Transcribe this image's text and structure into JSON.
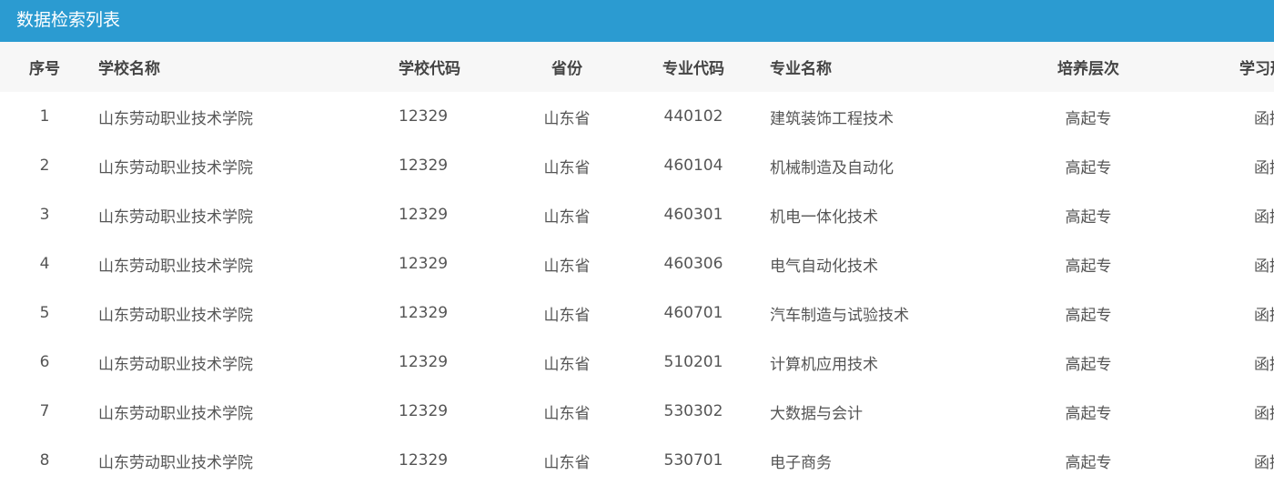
{
  "header": {
    "title": "数据检索列表"
  },
  "columns": {
    "index": "序号",
    "school_name": "学校名称",
    "school_code": "学校代码",
    "province": "省份",
    "major_code": "专业代码",
    "major_name": "专业名称",
    "level": "培养层次",
    "study_mode": "学习形式"
  },
  "rows": [
    {
      "index": "1",
      "school_name": "山东劳动职业技术学院",
      "school_code": "12329",
      "province": "山东省",
      "major_code": "440102",
      "major_name": "建筑装饰工程技术",
      "level": "高起专",
      "study_mode": "函授"
    },
    {
      "index": "2",
      "school_name": "山东劳动职业技术学院",
      "school_code": "12329",
      "province": "山东省",
      "major_code": "460104",
      "major_name": "机械制造及自动化",
      "level": "高起专",
      "study_mode": "函授"
    },
    {
      "index": "3",
      "school_name": "山东劳动职业技术学院",
      "school_code": "12329",
      "province": "山东省",
      "major_code": "460301",
      "major_name": "机电一体化技术",
      "level": "高起专",
      "study_mode": "函授"
    },
    {
      "index": "4",
      "school_name": "山东劳动职业技术学院",
      "school_code": "12329",
      "province": "山东省",
      "major_code": "460306",
      "major_name": "电气自动化技术",
      "level": "高起专",
      "study_mode": "函授"
    },
    {
      "index": "5",
      "school_name": "山东劳动职业技术学院",
      "school_code": "12329",
      "province": "山东省",
      "major_code": "460701",
      "major_name": "汽车制造与试验技术",
      "level": "高起专",
      "study_mode": "函授"
    },
    {
      "index": "6",
      "school_name": "山东劳动职业技术学院",
      "school_code": "12329",
      "province": "山东省",
      "major_code": "510201",
      "major_name": "计算机应用技术",
      "level": "高起专",
      "study_mode": "函授"
    },
    {
      "index": "7",
      "school_name": "山东劳动职业技术学院",
      "school_code": "12329",
      "province": "山东省",
      "major_code": "530302",
      "major_name": "大数据与会计",
      "level": "高起专",
      "study_mode": "函授"
    },
    {
      "index": "8",
      "school_name": "山东劳动职业技术学院",
      "school_code": "12329",
      "province": "山东省",
      "major_code": "530701",
      "major_name": "电子商务",
      "level": "高起专",
      "study_mode": "函授"
    }
  ]
}
